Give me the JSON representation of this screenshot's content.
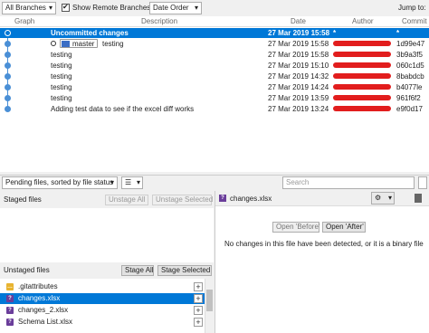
{
  "toolbar": {
    "branches": "All Branches",
    "show_remote_label": "Show Remote Branches",
    "show_remote_checked": true,
    "order": "Date Order",
    "jump_to": "Jump to:"
  },
  "columns": {
    "graph": "Graph",
    "description": "Description",
    "date": "Date",
    "author": "Author",
    "commit": "Commit"
  },
  "commits": [
    {
      "description": "Uncommitted changes",
      "date": "27 Mar 2019 15:58",
      "author": "*",
      "commit": "*",
      "selected": true
    },
    {
      "branch_tag": "master",
      "description": "testing",
      "date": "27 Mar 2019 15:58",
      "author": "",
      "commit": "1d99e47"
    },
    {
      "description": "testing",
      "date": "27 Mar 2019 15:58",
      "author": "",
      "commit": "3b9a3f5"
    },
    {
      "description": "testing",
      "date": "27 Mar 2019 15:10",
      "author": "",
      "commit": "060c1d5"
    },
    {
      "description": "testing",
      "date": "27 Mar 2019 14:32",
      "author": "",
      "commit": "8babdcb"
    },
    {
      "description": "testing",
      "date": "27 Mar 2019 14:24",
      "author": "",
      "commit": "b4077le"
    },
    {
      "description": "testing",
      "date": "27 Mar 2019 13:59",
      "author": "",
      "commit": "961f6f2"
    },
    {
      "description": "Adding test data to see if the excel diff works",
      "date": "27 Mar 2019 13:24",
      "author": "",
      "commit": "e9f0d17"
    }
  ],
  "pending": {
    "filter": "Pending files, sorted by file status",
    "search_placeholder": "Search"
  },
  "staged": {
    "title": "Staged files",
    "unstage_all": "Unstage All",
    "unstage_selected": "Unstage Selected"
  },
  "unstaged": {
    "title": "Unstaged files",
    "stage_all": "Stage All",
    "stage_selected": "Stage Selected",
    "files": [
      {
        "name": ".gitattributes",
        "status": "modified",
        "selected": false
      },
      {
        "name": "changes.xlsx",
        "status": "unknown",
        "selected": true
      },
      {
        "name": "changes_2.xlsx",
        "status": "unknown",
        "selected": false
      },
      {
        "name": "Schema List.xlsx",
        "status": "unknown",
        "selected": false
      }
    ]
  },
  "diff": {
    "file": "changes.xlsx",
    "open_before": "Open 'Before'",
    "open_after": "Open 'After'",
    "message": "No changes in this file have been detected, or it is a binary file"
  },
  "colors": {
    "selection": "#0078d7",
    "redaction": "#e21d1d",
    "modified_icon": "#e8b431",
    "unknown_icon": "#6a3d9a"
  }
}
